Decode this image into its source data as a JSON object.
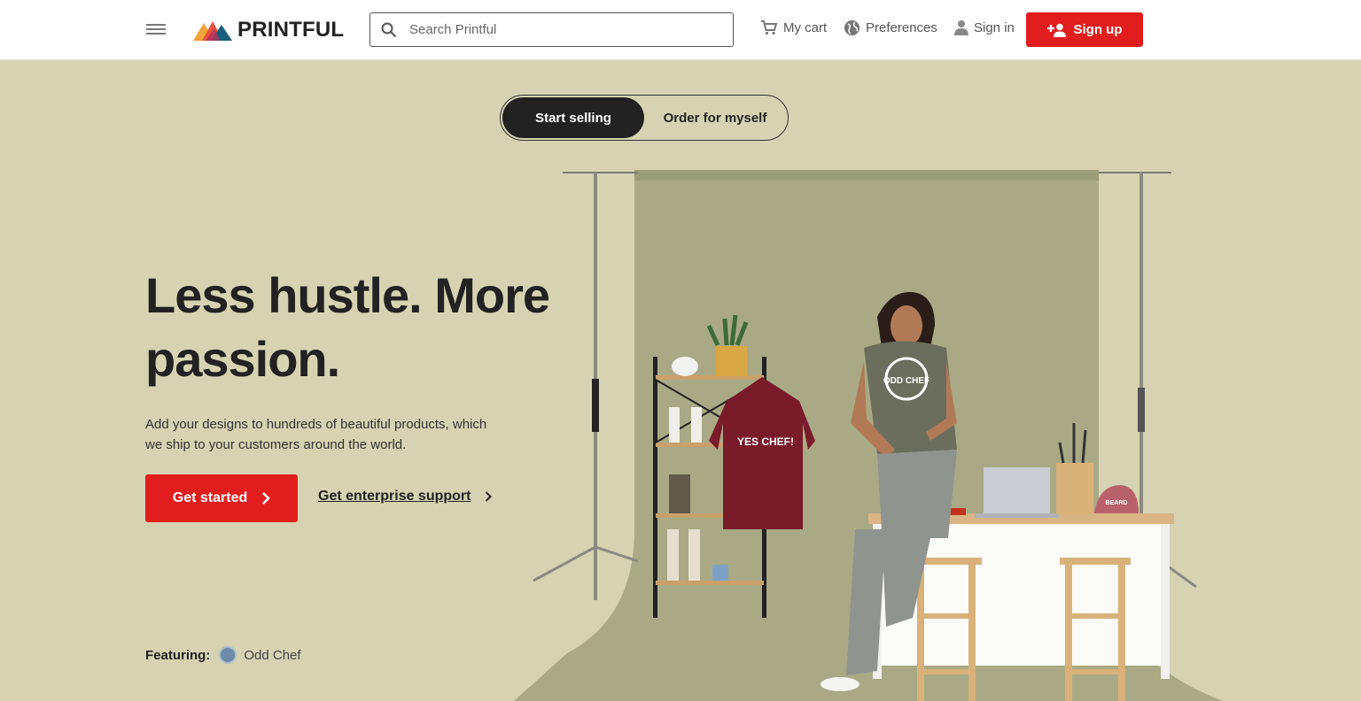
{
  "header": {
    "logo_text": "PRINTFUL",
    "search_placeholder": "Search Printful",
    "cart_label": "My cart",
    "preferences_label": "Preferences",
    "signin_label": "Sign in",
    "signup_label": "Sign up"
  },
  "hero": {
    "toggle": {
      "active_label": "Start selling",
      "inactive_label": "Order for myself"
    },
    "headline": "Less hustle. More passion.",
    "subtext": "Add your designs to hundreds of beautiful products, which we ship to your customers around the world.",
    "primary_cta": "Get started",
    "secondary_cta": "Get enterprise support",
    "featuring_label": "Featuring:",
    "featuring_name": "Odd Chef",
    "scene": {
      "sweatshirt_text": "YES CHEF!",
      "tshirt_text": "ODD CHEF",
      "cap_text": "BEARD"
    }
  },
  "colors": {
    "brand_red": "#e21d1d",
    "hero_bg": "#d5d3b1",
    "backdrop": "#a9aa85",
    "dark": "#222222"
  },
  "icons": [
    "menu-icon",
    "search-icon",
    "cart-icon",
    "globe-icon",
    "user-icon",
    "add-user-icon",
    "chevron-right-icon"
  ]
}
